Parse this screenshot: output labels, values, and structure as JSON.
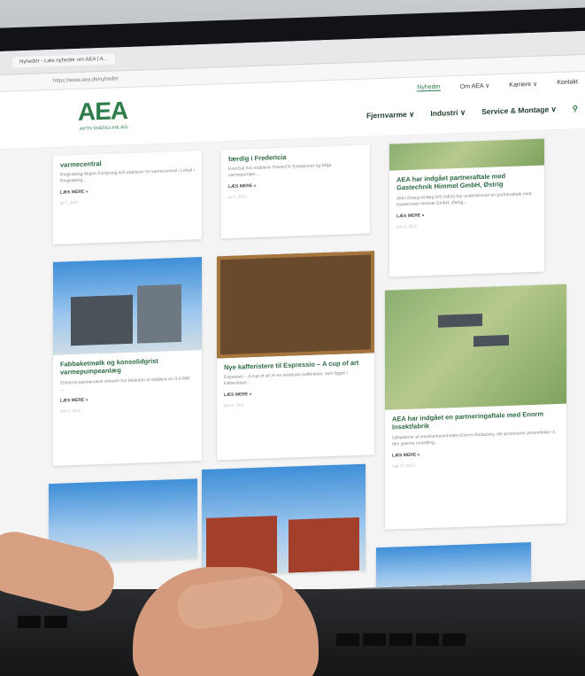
{
  "browser": {
    "tab_title": "Nyheder - Læs nyheder om AEA | A...",
    "address": "https://www.aea.dk/nyheder"
  },
  "site": {
    "logo_text": "AEA",
    "logo_sub": "AKTIV ENERGI ANLÆG",
    "top_nav": [
      "Nyheder",
      "Om AEA ∨",
      "Karriere ∨",
      "Kontakt"
    ],
    "main_nav": [
      "Fjernvarme ∨",
      "Industri ∨",
      "Service & Montage ∨"
    ],
    "search_icon": "search-icon"
  },
  "cards": [
    {
      "title": "varmecentral",
      "text": "Ringkøbing-Skjern Forsyning A/S etablerer en varmecentral i Lokalt i Ringkøbing...",
      "more": "LÆS MERE »",
      "date": "jul 7, 2022"
    },
    {
      "title": "færdig i Fredericia",
      "text": "EnerGal A/S etablerer PowerCK Emissioner og Miljø varmepumper...",
      "more": "LÆS MERE »",
      "date": "jul 7, 2022"
    },
    {
      "title": "AEA har indgået partneraftale med Gastechnik Himmel GmbH, Østrig",
      "text": "Aktiv Energi Anlæg A/S (AEA) har underskrevet en partneraftale med Gastechnik Himmel GmbH, Østrig...",
      "more": "LÆS MERE »",
      "date": "juni 8, 2022"
    },
    {
      "title": "Fabbaketmølk og konsolidgrist varmepumpeanlæg",
      "text": "Eksterne partnervære virksom har besluttet at etablere en 3-4 MW ...",
      "more": "LÆS MERE »",
      "date": "juni 7, 2022"
    },
    {
      "title": "Nye kafferistere til Espressio – A cup of art",
      "text": "Espressio – A cup of art er en eksklusiv kafferisteri, som ligger i København...",
      "more": "LÆS MERE »",
      "date": "juni 8, 2022"
    },
    {
      "title": "AEA har indgået en partneringaftale med Enorm Insektfabrik",
      "text": "Udsøderne af insektvirksomheden Enorm Biofactory, der producerer proteinfoder til den grønne omstilling...",
      "more": "LÆS MERE »",
      "date": "maj 17, 2022"
    }
  ]
}
